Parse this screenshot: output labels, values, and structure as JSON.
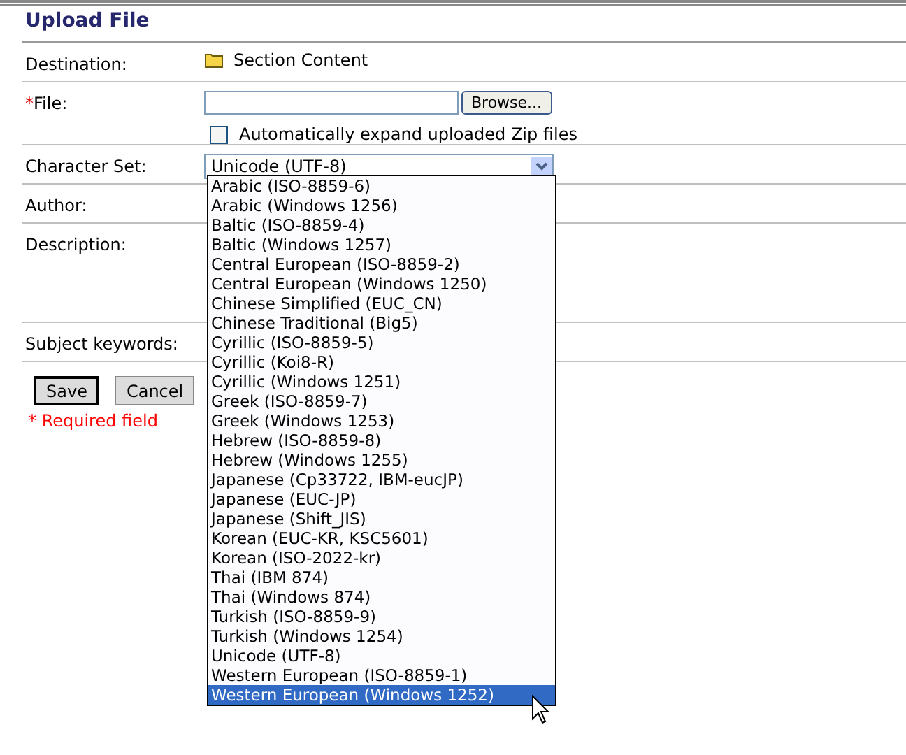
{
  "title": "Upload File",
  "rows": [
    {
      "kind": "destination",
      "label": "Destination:",
      "value": "Section Content"
    },
    {
      "kind": "file",
      "label": "File:",
      "required_mark": "*",
      "button": "Browse...",
      "checkbox": {
        "label": "Automatically expand uploaded Zip files",
        "checked": false
      }
    },
    {
      "kind": "select",
      "label": "Character Set:",
      "value": "Unicode (UTF-8)"
    },
    {
      "kind": "plain",
      "label": "Author:"
    },
    {
      "kind": "tall",
      "label": "Description:"
    },
    {
      "kind": "plain",
      "label": "Subject keywords:"
    }
  ],
  "buttons": [
    {
      "label": "Save",
      "default": true
    },
    {
      "label": "Cancel",
      "default": false
    }
  ],
  "required_note": "* Required field",
  "dropdown": [
    {
      "label": "Arabic (ISO-8859-6)",
      "selected": false
    },
    {
      "label": "Arabic (Windows 1256)",
      "selected": false
    },
    {
      "label": "Baltic (ISO-8859-4)",
      "selected": false
    },
    {
      "label": "Baltic (Windows 1257)",
      "selected": false
    },
    {
      "label": "Central European (ISO-8859-2)",
      "selected": false
    },
    {
      "label": "Central European (Windows 1250)",
      "selected": false
    },
    {
      "label": "Chinese Simplified (EUC_CN)",
      "selected": false
    },
    {
      "label": "Chinese Traditional (Big5)",
      "selected": false
    },
    {
      "label": "Cyrillic (ISO-8859-5)",
      "selected": false
    },
    {
      "label": "Cyrillic (Koi8-R)",
      "selected": false
    },
    {
      "label": "Cyrillic (Windows 1251)",
      "selected": false
    },
    {
      "label": "Greek (ISO-8859-7)",
      "selected": false
    },
    {
      "label": "Greek (Windows 1253)",
      "selected": false
    },
    {
      "label": "Hebrew (ISO-8859-8)",
      "selected": false
    },
    {
      "label": "Hebrew (Windows 1255)",
      "selected": false
    },
    {
      "label": "Japanese (Cp33722, IBM-eucJP)",
      "selected": false
    },
    {
      "label": "Japanese (EUC-JP)",
      "selected": false
    },
    {
      "label": "Japanese (Shift_JIS)",
      "selected": false
    },
    {
      "label": "Korean (EUC-KR, KSC5601)",
      "selected": false
    },
    {
      "label": "Korean (ISO-2022-kr)",
      "selected": false
    },
    {
      "label": "Thai (IBM 874)",
      "selected": false
    },
    {
      "label": "Thai (Windows 874)",
      "selected": false
    },
    {
      "label": "Turkish (ISO-8859-9)",
      "selected": false
    },
    {
      "label": "Turkish (Windows 1254)",
      "selected": false
    },
    {
      "label": "Unicode (UTF-8)",
      "selected": false
    },
    {
      "label": "Western European (ISO-8859-1)",
      "selected": false
    },
    {
      "label": "Western European (Windows 1252)",
      "selected": true
    }
  ]
}
